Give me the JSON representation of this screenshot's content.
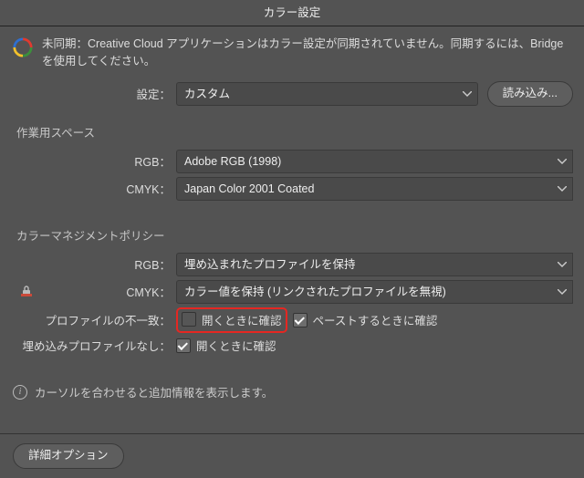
{
  "title": "カラー設定",
  "warning": {
    "prefix": "未同期：",
    "text": "Creative Cloud アプリケーションはカラー設定が同期されていません。同期するには、Bridgeを使用してください。"
  },
  "top": {
    "settings_label": "設定：",
    "settings_value": "カスタム",
    "load_button": "読み込み..."
  },
  "workspace": {
    "title": "作業用スペース",
    "rgb_label": "RGB：",
    "rgb_value": "Adobe RGB (1998)",
    "cmyk_label": "CMYK：",
    "cmyk_value": "Japan Color 2001 Coated"
  },
  "policy": {
    "title": "カラーマネジメントポリシー",
    "rgb_label": "RGB：",
    "rgb_value": "埋め込まれたプロファイルを保持",
    "cmyk_label": "CMYK：",
    "cmyk_value": "カラー値を保持 (リンクされたプロファイルを無視)",
    "mismatch_label": "プロファイルの不一致：",
    "open_check": "開くときに確認",
    "paste_check": "ペーストするときに確認",
    "missing_label": "埋め込みプロファイルなし：",
    "open_check2": "開くときに確認"
  },
  "info_text": "カーソルを合わせると追加情報を表示します。",
  "footer": {
    "advanced_button": "詳細オプション"
  }
}
